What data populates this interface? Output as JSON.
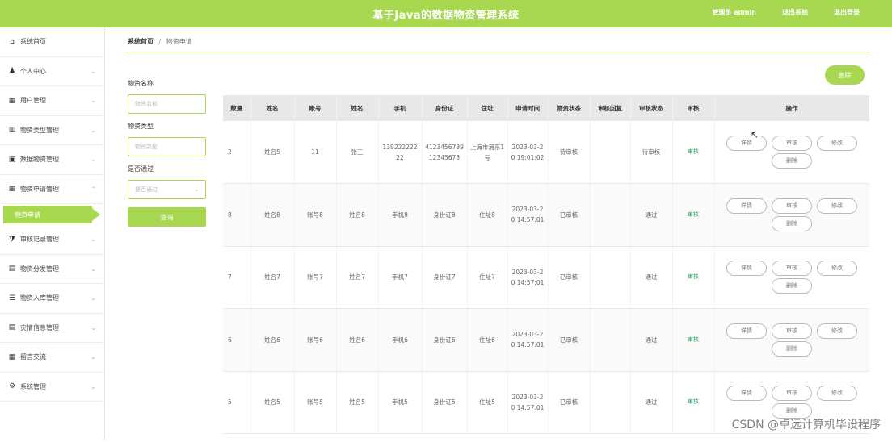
{
  "header": {
    "title": "基于Java的数据物资管理系统",
    "user": "管理员 admin",
    "back": "退出系统",
    "logout": "退出登录"
  },
  "sidebar": {
    "items": [
      {
        "label": "系统首页",
        "icon": "home-icon",
        "glyph": "⌂",
        "arrow": ""
      },
      {
        "label": "个人中心",
        "icon": "user-icon",
        "glyph": "♟",
        "arrow": "⌄"
      },
      {
        "label": "用户管理",
        "icon": "grid-icon",
        "glyph": "▦",
        "arrow": "⌄"
      },
      {
        "label": "物资类型管理",
        "icon": "bar-chart-icon",
        "glyph": "▥",
        "arrow": "⌄"
      },
      {
        "label": "数据物资管理",
        "icon": "box-icon",
        "glyph": "▣",
        "arrow": "⌄"
      },
      {
        "label": "物资申请管理",
        "icon": "grid-icon",
        "glyph": "▦",
        "arrow": "⌃"
      }
    ],
    "active_sub": "物资申请",
    "items_after": [
      {
        "label": "审核记录管理",
        "icon": "filter-icon",
        "glyph": "⧩",
        "arrow": "⌄"
      },
      {
        "label": "物资分发管理",
        "icon": "doc-icon",
        "glyph": "▤",
        "arrow": "⌄"
      },
      {
        "label": "物资入库管理",
        "icon": "list-icon",
        "glyph": "☰",
        "arrow": "⌄"
      },
      {
        "label": "灾情信息管理",
        "icon": "doc-icon",
        "glyph": "▤",
        "arrow": "⌄"
      },
      {
        "label": "留言交流",
        "icon": "grid-icon",
        "glyph": "▦",
        "arrow": "⌄"
      },
      {
        "label": "系统管理",
        "icon": "settings-icon",
        "glyph": "⚙",
        "arrow": "⌄"
      }
    ]
  },
  "breadcrumb": {
    "home": "系统首页",
    "sep": "/",
    "current": "物资申请"
  },
  "toolbar": {
    "delete": "删除"
  },
  "search": {
    "name_label": "物资名称",
    "name_placeholder": "物资名称",
    "type_label": "物资类型",
    "type_placeholder": "物资类型",
    "status_label": "是否通过",
    "status_placeholder": "是否通过",
    "query": "查询"
  },
  "table": {
    "headers": [
      "数量",
      "姓名",
      "账号",
      "姓名",
      "手机",
      "身份证",
      "住址",
      "申请时间",
      "物资状态",
      "审核回复",
      "审核状态",
      "审核",
      "操作"
    ],
    "rows": [
      {
        "c": [
          "2",
          "姓名5",
          "11",
          "张三",
          "13922222222",
          "412345678912345678",
          "上海市浦东1号",
          "2023-03-20 19:01:02",
          "待审核",
          "",
          "待审核",
          "审核"
        ]
      },
      {
        "c": [
          "8",
          "姓名8",
          "账号8",
          "姓名8",
          "手机8",
          "身份证8",
          "住址8",
          "2023-03-20 14:57:01",
          "已审核",
          "",
          "通过",
          "审核"
        ]
      },
      {
        "c": [
          "7",
          "姓名7",
          "账号7",
          "姓名7",
          "手机7",
          "身份证7",
          "住址7",
          "2023-03-20 14:57:01",
          "已审核",
          "",
          "通过",
          "审核"
        ]
      },
      {
        "c": [
          "6",
          "姓名6",
          "账号6",
          "姓名6",
          "手机6",
          "身份证6",
          "住址6",
          "2023-03-20 14:57:01",
          "已审核",
          "",
          "通过",
          "审核"
        ]
      },
      {
        "c": [
          "5",
          "姓名5",
          "账号5",
          "姓名5",
          "手机5",
          "身份证5",
          "住址5",
          "2023-03-20 14:57:01",
          "已审核",
          "",
          "通过",
          "审核"
        ]
      }
    ],
    "ops": [
      "详情",
      "审核",
      "修改",
      "删除"
    ]
  },
  "watermark": "CSDN @卓远计算机毕设程序",
  "colors": {
    "accent": "#a8d84f",
    "status_green": "#2aa56a"
  }
}
